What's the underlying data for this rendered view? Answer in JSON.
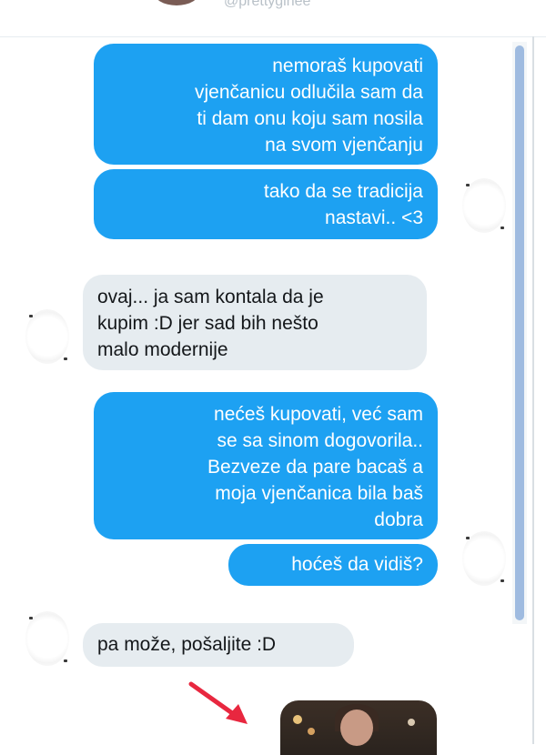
{
  "header": {
    "handle": "@prettyginee"
  },
  "messages": [
    {
      "dir": "out",
      "text": "nemoraš kupovati\nvjenčanicu odlučila sam da\nti dam onu koju sam nosila\nna svom vjenčanju"
    },
    {
      "dir": "out",
      "text": "tako da se tradicija\nnastavi.. <3"
    },
    {
      "dir": "in",
      "text": "ovaj... ja sam kontala da je\nkupim :D jer sad bih nešto\nmalo modernije"
    },
    {
      "dir": "out",
      "text": "nećeš kupovati, već sam\nse sa sinom dogovorila..\nBezveze da pare bacaš a\nmoja vjenčanica bila baš\ndobra"
    },
    {
      "dir": "out",
      "text": "hoćeš da vidiš?"
    },
    {
      "dir": "in",
      "text": "pa može, pošaljite :D"
    }
  ],
  "annotation": {
    "arrow_color": "#e8273f"
  },
  "colors": {
    "outgoing": "#1da1f2",
    "incoming": "#e6ecf0",
    "scroll_thumb": "#9fbbe0"
  }
}
